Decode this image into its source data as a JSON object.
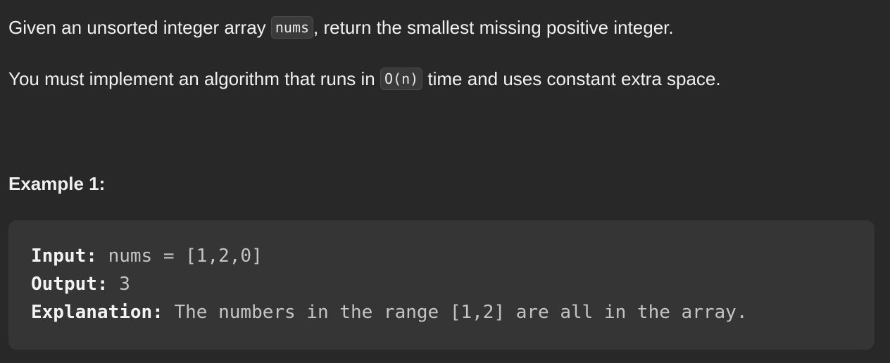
{
  "problem": {
    "para1": {
      "before": "Given an unsorted integer array ",
      "code": "nums",
      "after": ", return the smallest missing positive integer."
    },
    "para2": {
      "before": "You must implement an algorithm that runs in ",
      "code": "O(n)",
      "after": " time and uses constant extra space."
    }
  },
  "example": {
    "title": "Example 1:",
    "input_label": "Input:",
    "input_value": " nums = [1,2,0]",
    "output_label": "Output:",
    "output_value": " 3",
    "explanation_label": "Explanation:",
    "explanation_value": " The numbers in the range [1,2] are all in the array."
  }
}
